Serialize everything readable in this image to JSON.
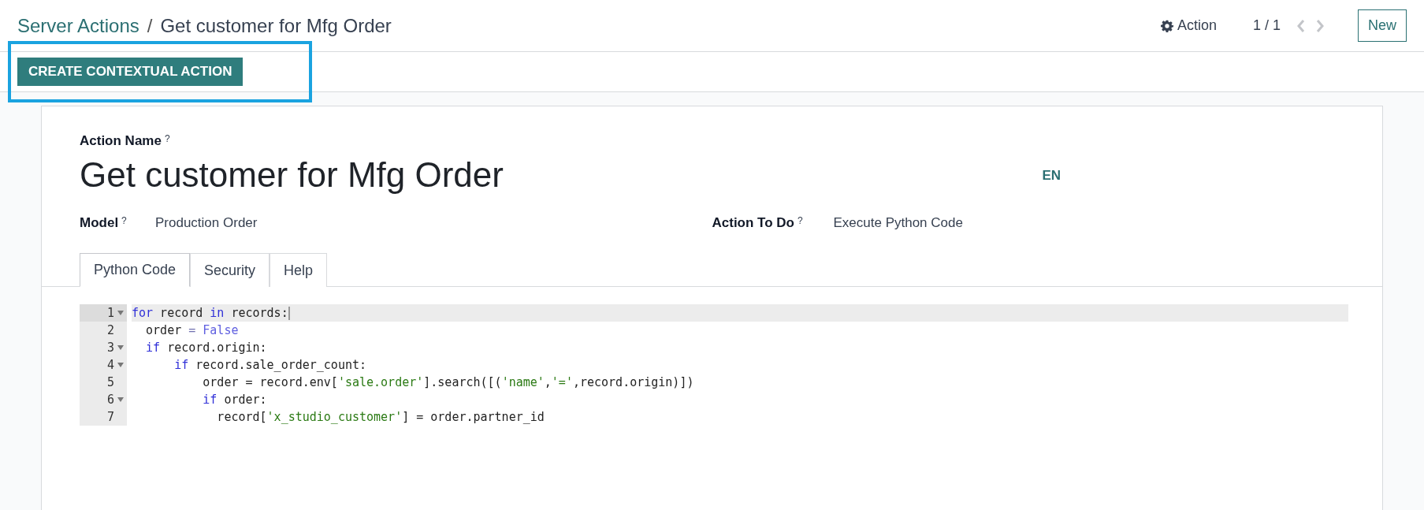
{
  "breadcrumb": {
    "parent": "Server Actions",
    "separator": "/",
    "current": "Get customer for Mfg Order"
  },
  "toolbar": {
    "action_label": "Action",
    "pager": "1 / 1",
    "new_label": "New"
  },
  "control_bar": {
    "button": "CREATE CONTEXTUAL ACTION",
    "highlighted": true
  },
  "form": {
    "name_label": "Action Name",
    "help_mark": "?",
    "name_value": "Get customer for Mfg Order",
    "language": "EN",
    "fields": [
      {
        "label": "Model",
        "help_mark": "?",
        "value": "Production Order"
      },
      {
        "label": "Action To Do",
        "help_mark": "?",
        "value": "Execute Python Code"
      }
    ],
    "tabs": [
      {
        "label": "Python Code",
        "selected": true
      },
      {
        "label": "Security",
        "selected": false
      },
      {
        "label": "Help",
        "selected": false
      }
    ],
    "code": {
      "lines": [
        {
          "number": "1",
          "foldable": true,
          "current": true,
          "tokens": [
            {
              "kind": "keyword",
              "text": "for"
            },
            {
              "kind": "plain",
              "text": " record "
            },
            {
              "kind": "keyword",
              "text": "in"
            },
            {
              "kind": "plain",
              "text": " records:"
            }
          ]
        },
        {
          "number": "2",
          "foldable": false,
          "current": false,
          "tokens": [
            {
              "kind": "plain",
              "text": "  order "
            },
            {
              "kind": "operator",
              "text": "="
            },
            {
              "kind": "constant",
              "text": " False"
            }
          ]
        },
        {
          "number": "3",
          "foldable": true,
          "current": false,
          "tokens": [
            {
              "kind": "keyword",
              "text": "  if"
            },
            {
              "kind": "plain",
              "text": " record.origin:"
            }
          ]
        },
        {
          "number": "4",
          "foldable": true,
          "current": false,
          "tokens": [
            {
              "kind": "keyword",
              "text": "      if"
            },
            {
              "kind": "plain",
              "text": " record.sale_order_count:"
            }
          ]
        },
        {
          "number": "5",
          "foldable": false,
          "current": false,
          "tokens": [
            {
              "kind": "plain",
              "text": "          order = record.env["
            },
            {
              "kind": "string",
              "text": "'sale.order'"
            },
            {
              "kind": "plain",
              "text": "].search([("
            },
            {
              "kind": "string",
              "text": "'name'"
            },
            {
              "kind": "plain",
              "text": ","
            },
            {
              "kind": "string",
              "text": "'='"
            },
            {
              "kind": "plain",
              "text": ",record.origin)])"
            }
          ]
        },
        {
          "number": "6",
          "foldable": true,
          "current": false,
          "tokens": [
            {
              "kind": "keyword",
              "text": "          if"
            },
            {
              "kind": "plain",
              "text": " order:"
            }
          ]
        },
        {
          "number": "7",
          "foldable": false,
          "current": false,
          "tokens": [
            {
              "kind": "plain",
              "text": "            record["
            },
            {
              "kind": "string",
              "text": "'x_studio_customer'"
            },
            {
              "kind": "plain",
              "text": "] = order.partner_id"
            }
          ]
        }
      ]
    }
  }
}
